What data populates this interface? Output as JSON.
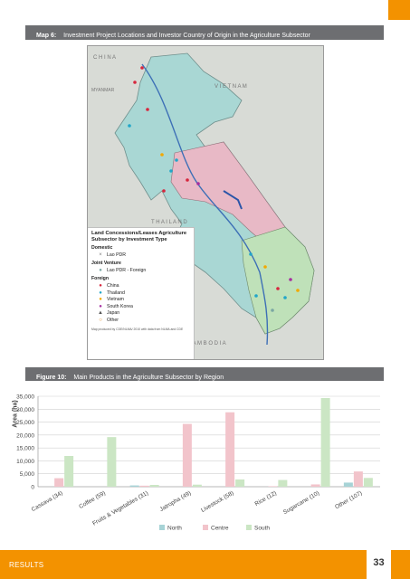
{
  "map": {
    "caption_label": "Map 6:",
    "caption_text": "Investment Project Locations and Investor Country of Origin in the Agriculture Subsector",
    "labels": {
      "china": "C H I N A",
      "myanmar": "MYANMAR",
      "vietnam": "V I E T N A M",
      "thailand": "T H A I L A N D",
      "cambodia": "C A M B O D I A"
    },
    "legend": {
      "title": "Land Concessions/Leases Agriculture Subsector by Investment Type",
      "domestic_heading": "Domestic",
      "domestic_items": [
        {
          "label": "Lao PDR",
          "symbol": "×",
          "color": "#7f7f7f"
        }
      ],
      "joint_heading": "Joint Venture",
      "joint_items": [
        {
          "label": "Lao PDR - Foreign",
          "symbol": "●",
          "color": "#7aa7a3"
        }
      ],
      "foreign_heading": "Foreign",
      "foreign_items": [
        {
          "label": "China",
          "symbol": "●",
          "color": "#d7263d"
        },
        {
          "label": "Thailand",
          "symbol": "●",
          "color": "#22a6c9"
        },
        {
          "label": "Vietnam",
          "symbol": "●",
          "color": "#f2a900"
        },
        {
          "label": "South Korea",
          "symbol": "●",
          "color": "#a62ea0"
        },
        {
          "label": "Japan",
          "symbol": "▲",
          "color": "#555555"
        },
        {
          "label": "Other",
          "symbol": "○",
          "color": "#e08a1e"
        }
      ],
      "note": "Map produced by CDE/NLMA/ 2010 with data from NLMA and CDE"
    }
  },
  "figure": {
    "caption_label": "Figure 10:",
    "caption_text": "Main Products in the Agriculture Subsector by Region"
  },
  "chart_data": {
    "type": "bar",
    "ylabel": "Area (ha)",
    "xlabel": "",
    "ylim": [
      0,
      35000
    ],
    "yticks": [
      "0",
      "5,000",
      "10,000",
      "15,000",
      "20,000",
      "25,000",
      "30,000",
      "35,000"
    ],
    "grid": true,
    "legend_position": "bottom",
    "categories": [
      "Cassava (34)",
      "Coffee (59)",
      "Fruits & Vegetables (31)",
      "Jatropha (49)",
      "Livestock (58)",
      "Rice (12)",
      "Sugarcane (10)",
      "Other (107)"
    ],
    "series": [
      {
        "name": "North",
        "color": "#a7d3d6",
        "values": [
          0,
          0,
          500,
          0,
          0,
          0,
          0,
          1600
        ]
      },
      {
        "name": "Centre",
        "color": "#f2c4cb",
        "values": [
          3300,
          0,
          400,
          24300,
          28800,
          200,
          900,
          5900
        ]
      },
      {
        "name": "South",
        "color": "#cbe6c4",
        "values": [
          11900,
          19200,
          700,
          800,
          2800,
          2600,
          34300,
          3400
        ]
      }
    ]
  },
  "footer": {
    "section": "RESULTS",
    "page": "33"
  }
}
